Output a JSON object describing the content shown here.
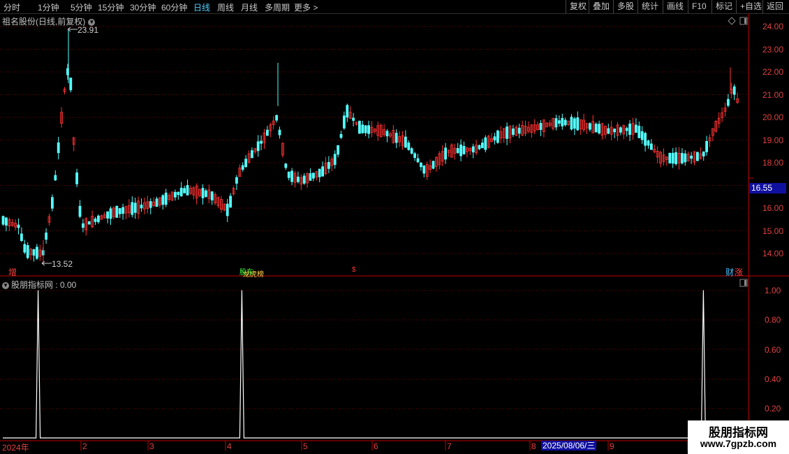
{
  "toolbar": {
    "periods": [
      "分时",
      "1分钟",
      "5分钟",
      "15分钟",
      "30分钟",
      "60分钟",
      "日线",
      "周线",
      "月线",
      "多周期",
      "更多 >"
    ],
    "active_period": "日线",
    "actions": [
      "复权",
      "叠加",
      "多股",
      "统计",
      "画线",
      "F10",
      "标记",
      "+自选",
      "返回"
    ]
  },
  "main_chart": {
    "title": "祖名股份(日线,前复权)",
    "high_annotation": "23.91",
    "low_annotation": "13.52",
    "current_price": "16.55",
    "price_labels": [
      "24.00",
      "23.00",
      "22.00",
      "21.00",
      "20.00",
      "19.00",
      "18.00",
      "16.00",
      "15.00",
      "14.00"
    ],
    "events": [
      {
        "text": "增",
        "color": "#ff4040"
      },
      {
        "text": "股东",
        "color": "#40ff40"
      },
      {
        "text": "龙虎榜",
        "color": "#ffd040"
      },
      {
        "text": "$",
        "color": "#ff3030"
      },
      {
        "text": "财",
        "color": "#40c0ff"
      },
      {
        "text": "涨",
        "color": "#ff4040"
      }
    ]
  },
  "indicator": {
    "title": "股朋指标网 : 0.00",
    "labels": [
      "1.00",
      "0.80",
      "0.60",
      "0.40",
      "0.20"
    ]
  },
  "date_axis": {
    "labels": [
      "2024年",
      "2",
      "3",
      "4",
      "5",
      "6",
      "7",
      "8",
      "9"
    ],
    "selected_date": "2025/08/06/三"
  },
  "watermark": {
    "title": "股朋指标网",
    "url": "www.7gpzb.com"
  },
  "colors": {
    "up": "#ff3333",
    "down": "#54ffff",
    "grid": "#7a0000",
    "axis": "#c00000",
    "highlight": "#1010a0"
  },
  "chart_data": {
    "type": "line",
    "series": [
      {
        "values": [
          0,
          0,
          0,
          0,
          0,
          0,
          0,
          0,
          0,
          0,
          0,
          0,
          0,
          0,
          0,
          0,
          0,
          1,
          0,
          0,
          0,
          0,
          0,
          0,
          0,
          0,
          0,
          0,
          0,
          0,
          0,
          0,
          0,
          0,
          0,
          0,
          0,
          0,
          0,
          0,
          0,
          0,
          0,
          0,
          0,
          0,
          0,
          0,
          0,
          0,
          0,
          0,
          0,
          0,
          0,
          0,
          0,
          0,
          0,
          0,
          0,
          0,
          0,
          0,
          0,
          0,
          0,
          0,
          0,
          0,
          0,
          0,
          0,
          0,
          0,
          0,
          0,
          0,
          0,
          0,
          0,
          0,
          0,
          0,
          0,
          0,
          0,
          0,
          0,
          0,
          0,
          0,
          0,
          0,
          0,
          0,
          0,
          0,
          0,
          0,
          0,
          0,
          0,
          0,
          0,
          0,
          0,
          0,
          0,
          0,
          0,
          0,
          0,
          0,
          0,
          1,
          0,
          0,
          0,
          0,
          0,
          0,
          0,
          0,
          0,
          0,
          0,
          0,
          0,
          0,
          0,
          0,
          0,
          0,
          0,
          0,
          0,
          0,
          0,
          0,
          0,
          0,
          0,
          0,
          0,
          0,
          0,
          0,
          0,
          0,
          0,
          0,
          0,
          0,
          0,
          0,
          0,
          0,
          0,
          0,
          0,
          0,
          0,
          0,
          0,
          0,
          0,
          0,
          0,
          0,
          0,
          0,
          0,
          0,
          0,
          0,
          0,
          0,
          0,
          0,
          0,
          0,
          0,
          0,
          0,
          0,
          0,
          0,
          0,
          0,
          0,
          0,
          0,
          0,
          0,
          0,
          0,
          0,
          0,
          0,
          0,
          0,
          0,
          0,
          0,
          0,
          0,
          0,
          0,
          0,
          0,
          0,
          0,
          0,
          0,
          0,
          0,
          0,
          0,
          0,
          0,
          0,
          0,
          0,
          0,
          0,
          0,
          0,
          0,
          0,
          0,
          0,
          0,
          0,
          0,
          0,
          0,
          0,
          0,
          0,
          0,
          0,
          0,
          0,
          0,
          0,
          0,
          0,
          0,
          0,
          0,
          0,
          0,
          0,
          0,
          0,
          0,
          0,
          0,
          0,
          0,
          0,
          0,
          0,
          0,
          0,
          0,
          0,
          0,
          0,
          0,
          0,
          0,
          0,
          0,
          0,
          0,
          0,
          0,
          0,
          0,
          0,
          0,
          0,
          0,
          0,
          0,
          0,
          0,
          0,
          0,
          0,
          0,
          0,
          0,
          0,
          0,
          0,
          0,
          0,
          0,
          0,
          0,
          0,
          0,
          0,
          0,
          0,
          0,
          0,
          0,
          0,
          0,
          0,
          0,
          0,
          0,
          0,
          0,
          0,
          0,
          0,
          0,
          0,
          0,
          0,
          0,
          0,
          0,
          0,
          0,
          0,
          0,
          0,
          0,
          0,
          0,
          1,
          0,
          0,
          0,
          0,
          0,
          0,
          0,
          0,
          0,
          0,
          0,
          0,
          0,
          0,
          0,
          0,
          0,
          0,
          0
        ]
      }
    ],
    "ylim": [
      0,
      1.0
    ]
  }
}
